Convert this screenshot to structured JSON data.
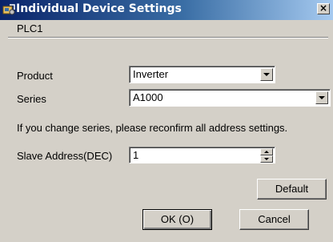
{
  "window": {
    "title": "Individual Device Settings",
    "close_symbol": "×"
  },
  "device": {
    "name": "PLC1"
  },
  "form": {
    "product": {
      "label": "Product",
      "value": "Inverter"
    },
    "series": {
      "label": "Series",
      "value": "A1000"
    },
    "notice": "If you change series, please reconfirm all address settings.",
    "slave_address": {
      "label": "Slave Address(DEC)",
      "value": "1"
    }
  },
  "buttons": {
    "default": "Default",
    "ok": "OK (O)",
    "cancel": "Cancel"
  },
  "icons": {
    "title": "app-icon",
    "dropdown": "chevron-down-icon",
    "spin_up": "arrow-up-icon",
    "spin_down": "arrow-down-icon"
  }
}
